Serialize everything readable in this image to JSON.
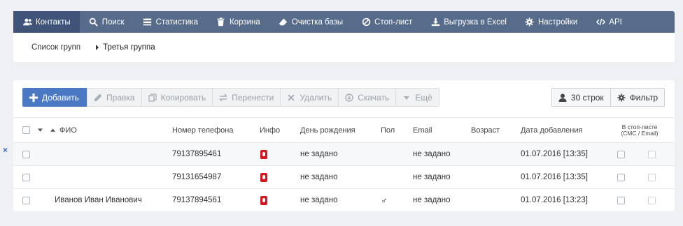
{
  "nav": {
    "items": [
      {
        "label": "Контакты",
        "icon": "users-icon"
      },
      {
        "label": "Поиск",
        "icon": "search-icon"
      },
      {
        "label": "Статистика",
        "icon": "stats-icon"
      },
      {
        "label": "Корзина",
        "icon": "trash-icon"
      },
      {
        "label": "Очистка базы",
        "icon": "eraser-icon"
      },
      {
        "label": "Стоп-лист",
        "icon": "ban-icon"
      },
      {
        "label": "Выгрузка в Excel",
        "icon": "download-icon"
      },
      {
        "label": "Настройки",
        "icon": "gear-icon"
      },
      {
        "label": "API",
        "icon": "code-icon"
      }
    ],
    "active_index": 0
  },
  "breadcrumb": {
    "link": "Список групп",
    "current": "Третья группа"
  },
  "toolbar": {
    "add": "Добавить",
    "edit": "Правка",
    "copy": "Копировать",
    "move": "Перенести",
    "delete": "Удалить",
    "download": "Скачать",
    "more": "Ещё"
  },
  "right_tools": {
    "rows": "30 строк",
    "filter": "Фильтр"
  },
  "table": {
    "columns": {
      "name": "ФИО",
      "phone": "Номер телефона",
      "info": "Инфо",
      "birthday": "День рождения",
      "gender": "Пол",
      "email": "Email",
      "age": "Возраст",
      "added": "Дата добавления",
      "stop_line1": "В стоп-листе",
      "stop_line2": "(СМС / Email)"
    },
    "rows": [
      {
        "name": "",
        "phone": "79137895461",
        "birthday": "не задано",
        "gender": "",
        "email": "не задано",
        "age": "",
        "added": "01.07.2016 [13:35]"
      },
      {
        "name": "",
        "phone": "79131654987",
        "birthday": "не задано",
        "gender": "",
        "email": "не задано",
        "age": "",
        "added": "01.07.2016 [13:35]"
      },
      {
        "name": "Иванов Иван Иванович",
        "phone": "79137894561",
        "birthday": "не задано",
        "gender": "♂",
        "email": "не задано",
        "age": "",
        "added": "01.07.2016 [13:23]"
      }
    ]
  },
  "row_marker": "×"
}
